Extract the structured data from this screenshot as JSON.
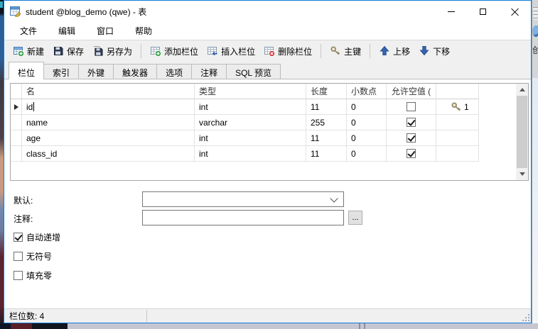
{
  "window": {
    "title": "student @blog_demo (qwe) - 表",
    "icon": "table-editor-icon",
    "controls": [
      {
        "name": "minimize"
      },
      {
        "name": "maximize"
      },
      {
        "name": "close"
      }
    ]
  },
  "menu": {
    "items": [
      "文件",
      "编辑",
      "窗口",
      "帮助"
    ]
  },
  "toolbar": {
    "items": [
      {
        "type": "button",
        "label": "新建",
        "icon": "new-table-icon"
      },
      {
        "type": "button",
        "label": "保存",
        "icon": "save-icon"
      },
      {
        "type": "button",
        "label": "另存为",
        "icon": "save-as-icon"
      },
      {
        "type": "separator"
      },
      {
        "type": "button",
        "label": "添加栏位",
        "icon": "add-field-icon"
      },
      {
        "type": "button",
        "label": "插入栏位",
        "icon": "insert-field-icon"
      },
      {
        "type": "button",
        "label": "删除栏位",
        "icon": "delete-field-icon"
      },
      {
        "type": "separator"
      },
      {
        "type": "button",
        "label": "主键",
        "icon": "primary-key-icon"
      },
      {
        "type": "separator"
      },
      {
        "type": "button",
        "label": "上移",
        "icon": "move-up-icon"
      },
      {
        "type": "button",
        "label": "下移",
        "icon": "move-down-icon"
      }
    ]
  },
  "tabs": [
    {
      "label": "栏位",
      "active": true
    },
    {
      "label": "索引",
      "active": false
    },
    {
      "label": "外键",
      "active": false
    },
    {
      "label": "触发器",
      "active": false
    },
    {
      "label": "选项",
      "active": false
    },
    {
      "label": "注释",
      "active": false
    },
    {
      "label": "SQL 预览",
      "active": false
    }
  ],
  "grid": {
    "columns": [
      "名",
      "类型",
      "长度",
      "小数点",
      "允许空值 (",
      ""
    ],
    "rows": [
      {
        "name": "id",
        "type": "int",
        "length": "11",
        "decimals": "0",
        "allow_null": false,
        "key": "1",
        "current": true
      },
      {
        "name": "name",
        "type": "varchar",
        "length": "255",
        "decimals": "0",
        "allow_null": true,
        "key": "",
        "current": false
      },
      {
        "name": "age",
        "type": "int",
        "length": "11",
        "decimals": "0",
        "allow_null": true,
        "key": "",
        "current": false
      },
      {
        "name": "class_id",
        "type": "int",
        "length": "11",
        "decimals": "0",
        "allow_null": true,
        "key": "",
        "current": false
      }
    ]
  },
  "field_props": {
    "default_label": "默认:",
    "default_value": "",
    "comment_label": "注释:",
    "comment_value": "",
    "browse_button_label": "...",
    "checkboxes": [
      {
        "label": "自动递增",
        "checked": true
      },
      {
        "label": "无符号",
        "checked": false
      },
      {
        "label": "填充零",
        "checked": false
      }
    ]
  },
  "status_bar": {
    "fields_count_text": "栏位数: 4"
  },
  "background": {
    "right_edge_text": "创"
  },
  "colors": {
    "accent_border": "#0f7bd7",
    "toolbar_bg": "#f0f0f0",
    "key_gold": "#8f8560",
    "arrow_blue": "#3565b0",
    "delete_red": "#d33a3a",
    "add_green": "#2f9e3f"
  }
}
